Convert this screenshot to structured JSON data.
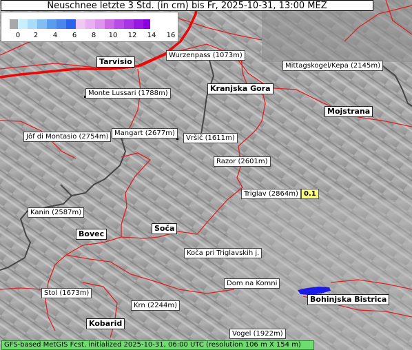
{
  "title": "Neuschnee letzte 3 Std. (in cm) bis Fr, 2025-10-31, 13:00 MEZ",
  "legend": {
    "ticks": [
      "0",
      "2",
      "4",
      "6",
      "8",
      "10",
      "12",
      "14",
      "16"
    ],
    "colors": [
      "#f0f0f0",
      "#c8eefa",
      "#a0dcf8",
      "#78b8f0",
      "#4a90e8",
      "#1e60e0",
      "#f0b8f0",
      "#e08ce8",
      "#c45ce0",
      "#a830e0",
      "#8800e0"
    ]
  },
  "places": {
    "tarvisio": "Tarvisio",
    "wurzenpass": "Wurzenpass (1073m)",
    "mittagskogel": "Mittagskogel/Kepa (2145m)",
    "monte_lussari": "Monte Lussari (1788m)",
    "kranjska_gora": "Kranjska Gora",
    "mojstrana": "Mojstrana",
    "jof_di_montasio": "Jôf di Montasio (2754m)",
    "mangart": "Mangart (2677m)",
    "vrsic": "Vršič (1611m)",
    "razor": "Razor (2601m)",
    "triglav": "Triglav (2864m)",
    "triglav_value": "0.1",
    "kanin": "Kanin (2587m)",
    "bovec": "Bovec",
    "soca": "Soča",
    "koca": "Koča pri Triglavskih j.",
    "dom_na_komni": "Dom na Komni",
    "stol": "Stol (1673m)",
    "bohinjska_bistrica": "Bohinjska Bistrica",
    "krn": "Krn (2244m)",
    "kobarid": "Kobarid",
    "vogel": "Vogel (1922m)"
  },
  "footer": "GFS-based MetGIS Fcst, initialized 2025-10-31, 06:00 UTC  (resolution 106 m X 154 m)"
}
